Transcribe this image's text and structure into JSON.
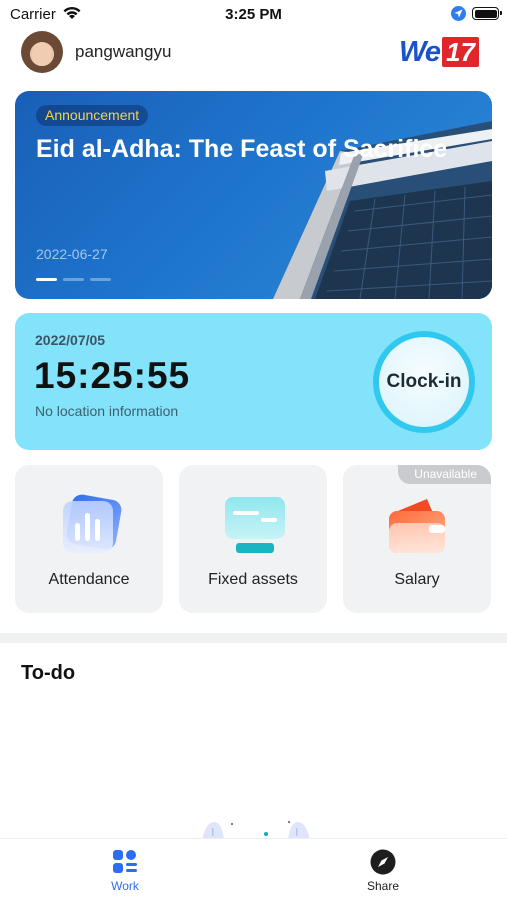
{
  "status_bar": {
    "carrier": "Carrier",
    "time": "3:25 PM",
    "wifi_icon": "wifi-icon",
    "location_icon": "location-arrow-icon",
    "battery_icon": "battery-full-icon"
  },
  "header": {
    "username": "pangwangyu",
    "logo": {
      "text": "We",
      "number": "17",
      "colors": {
        "text": "#1a52c9",
        "badge": "#e0262b"
      }
    }
  },
  "banner": {
    "badge": "Announcement",
    "title": "Eid al-Adha: The Feast of Sacrifice",
    "date": "2022-06-27",
    "pages": 3,
    "active_page": 1
  },
  "clock": {
    "date": "2022/07/05",
    "time": "15:25:55",
    "location": "No location information",
    "button_label": "Clock-in",
    "card_color": "#82e3fb"
  },
  "tiles": [
    {
      "label": "Attendance",
      "icon": "attendance-chart-icon"
    },
    {
      "label": "Fixed assets",
      "icon": "fixed-assets-monitor-icon"
    },
    {
      "label": "Salary",
      "icon": "salary-wallet-icon",
      "badge": "Unavailable"
    }
  ],
  "todo": {
    "title": "To-do"
  },
  "tab_bar": {
    "items": [
      {
        "label": "Work",
        "icon": "work-grid-icon",
        "active": true
      },
      {
        "label": "Share",
        "icon": "share-compass-icon",
        "active": false
      }
    ],
    "active_color": "#2b6ef2"
  }
}
